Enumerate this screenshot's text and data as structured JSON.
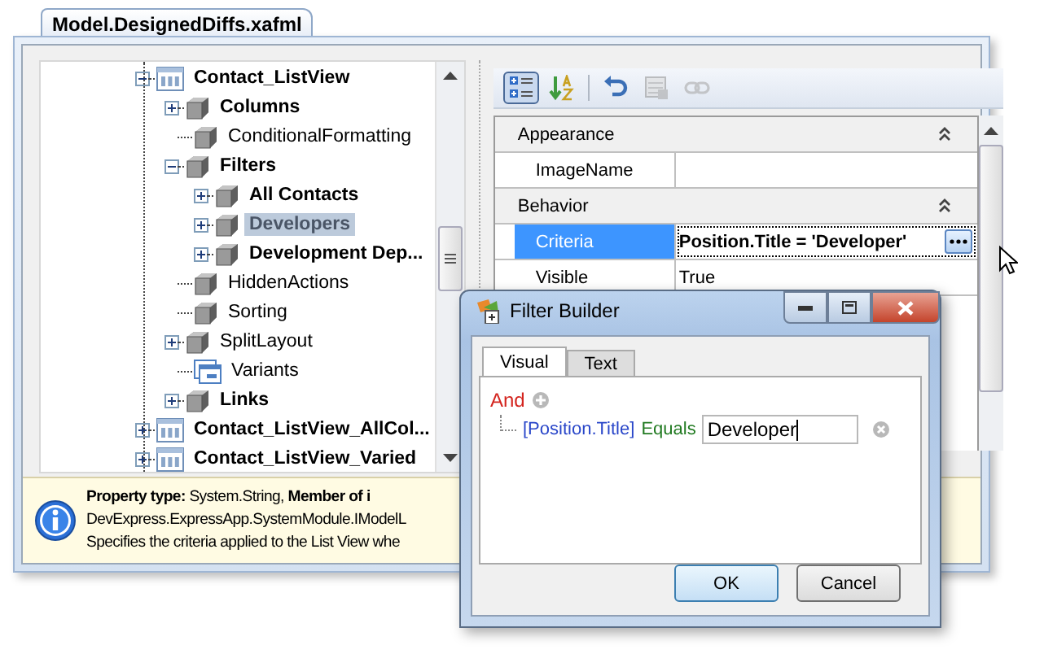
{
  "document_tab": {
    "label": "Model.DesignedDiffs.xafml",
    "selected": true
  },
  "tree": [
    {
      "label": "Contact_ListView",
      "kind": "listview",
      "modified": true,
      "expanded": true,
      "selected": false,
      "children": [
        {
          "label": "Columns",
          "kind": "node",
          "modified": true,
          "expanded": false,
          "selected": false
        },
        {
          "label": "ConditionalFormatting",
          "kind": "node",
          "modified": false,
          "selected": false
        },
        {
          "label": "Filters",
          "kind": "node",
          "modified": true,
          "expanded": true,
          "selected": false,
          "children": [
            {
              "label": "All Contacts",
              "kind": "node",
              "modified": true,
              "expanded": false,
              "selected": false
            },
            {
              "label": "Developers",
              "kind": "node",
              "modified": true,
              "expanded": false,
              "selected": true
            },
            {
              "label": "Development Dep...",
              "kind": "node",
              "modified": true,
              "expanded": false,
              "selected": false
            }
          ]
        },
        {
          "label": "HiddenActions",
          "kind": "node",
          "modified": false,
          "selected": false
        },
        {
          "label": "Sorting",
          "kind": "node",
          "modified": false,
          "selected": false
        },
        {
          "label": "SplitLayout",
          "kind": "node",
          "modified": false,
          "expanded": false,
          "selected": false
        },
        {
          "label": "Variants",
          "kind": "variants",
          "modified": false,
          "selected": false
        },
        {
          "label": "Links",
          "kind": "node",
          "modified": true,
          "expanded": false,
          "selected": false
        }
      ]
    },
    {
      "label": "Contact_ListView_AllCol...",
      "kind": "listview",
      "modified": true,
      "expanded": false,
      "selected": false
    },
    {
      "label": "Contact_ListView_Varied",
      "kind": "listview",
      "modified": true,
      "expanded": false,
      "selected": false
    }
  ],
  "property_toolbar": [
    {
      "kind": "categorized",
      "pressed": true,
      "disabled": false
    },
    {
      "kind": "alphabetical",
      "pressed": false,
      "disabled": false
    },
    {
      "kind": "undo",
      "pressed": false,
      "disabled": false
    },
    {
      "kind": "grid",
      "pressed": false,
      "disabled": true
    },
    {
      "kind": "link",
      "pressed": false,
      "disabled": true
    }
  ],
  "property_grid": [
    {
      "category": "Appearance",
      "expanded": true,
      "rows": [
        {
          "name": "ImageName",
          "selected": false,
          "kind": "text"
        }
      ]
    },
    {
      "category": "Behavior",
      "expanded": true,
      "rows": [
        {
          "name": "Criteria",
          "value": "Position.Title = 'Developer'",
          "selected": true,
          "modified": true,
          "kind": "ellipsis"
        },
        {
          "name": "Visible",
          "value": "True",
          "selected": false,
          "modified": false,
          "kind": "text"
        }
      ]
    }
  ],
  "info_panel": {
    "lines": [
      "**Property type:** System.String,  **Member of i**",
      "DevExpress.ExpressApp.SystemModule.IModelL",
      "Specifies the criteria applied to the List View whe"
    ]
  },
  "filter_builder": {
    "title": "Filter Builder",
    "tabs": [
      {
        "label": "Visual",
        "selected": true
      },
      {
        "label": "Text",
        "selected": false
      }
    ],
    "group": {
      "operator": "And",
      "conditions": [
        {
          "field": "[Position.Title]",
          "operation": "Equals",
          "value": "Developer"
        }
      ]
    },
    "buttons": [
      {
        "label": "OK",
        "default": true
      },
      {
        "label": "Cancel",
        "default": false
      }
    ]
  }
}
